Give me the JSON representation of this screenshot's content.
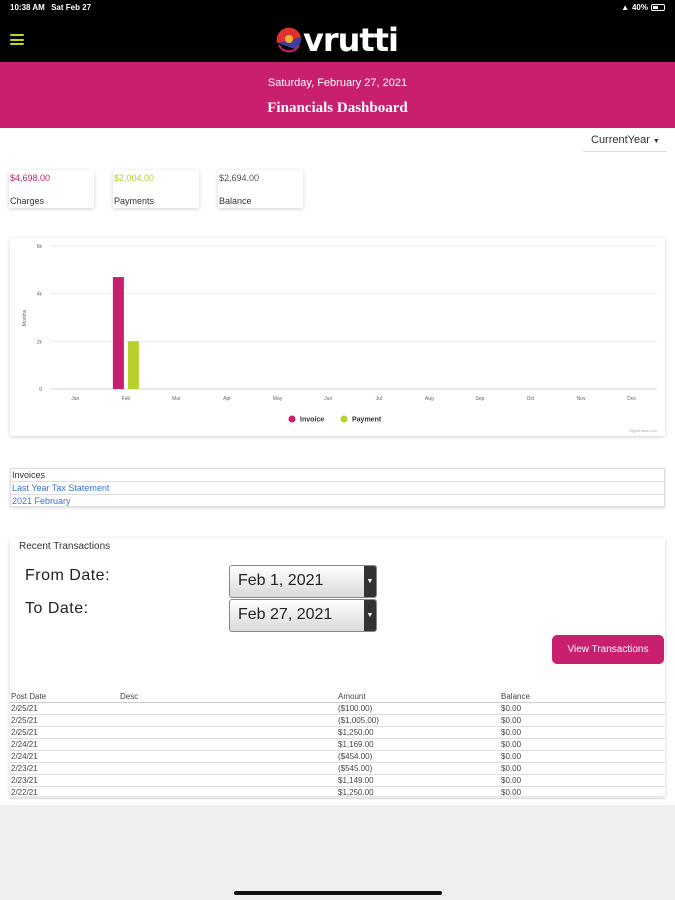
{
  "status": {
    "time": "10:38 AM",
    "date": "Sat Feb 27",
    "battery": "40%"
  },
  "app": {
    "logo_text": "vrutti"
  },
  "header": {
    "date": "Saturday, February 27, 2021",
    "title": "Financials Dashboard"
  },
  "year_filter": {
    "selected": "CurrentYear"
  },
  "summary": [
    {
      "amount": "$4,698.00",
      "label": "Charges",
      "color": "#c81f6e"
    },
    {
      "amount": "$2,004.00",
      "label": "Payments",
      "color": "#b8cf2c"
    },
    {
      "amount": "$2,694.00",
      "label": "Balance",
      "color": "#555555"
    }
  ],
  "chart_data": {
    "type": "bar",
    "categories": [
      "Jan",
      "Feb",
      "Mar",
      "Apr",
      "May",
      "Jun",
      "Jul",
      "Aug",
      "Sep",
      "Oct",
      "Nov",
      "Dec"
    ],
    "series": [
      {
        "name": "Invoice",
        "color": "#c81f6e",
        "values": [
          0,
          4698,
          0,
          0,
          0,
          0,
          0,
          0,
          0,
          0,
          0,
          0
        ]
      },
      {
        "name": "Payment",
        "color": "#b8cf2c",
        "values": [
          0,
          2004,
          0,
          0,
          0,
          0,
          0,
          0,
          0,
          0,
          0,
          0
        ]
      }
    ],
    "ylabel": "Months",
    "yticks": [
      "0",
      "2k",
      "4k",
      "6k"
    ],
    "ylim": [
      0,
      6000
    ],
    "legend_position": "bottom",
    "credit": "Highcharts.com"
  },
  "invoices": {
    "header": "Invoices",
    "links": [
      "Last Year Tax Statement",
      "2021 February"
    ]
  },
  "transactions": {
    "title": "Recent Transactions",
    "from_label": "From Date:",
    "to_label": "To Date:",
    "from_value": "Feb 1, 2021",
    "to_value": "Feb 27, 2021",
    "view_button": "View Transactions",
    "columns": [
      "Post Date",
      "Desc",
      "Amount",
      "Balance"
    ],
    "rows": [
      [
        "2/25/21",
        "",
        "($100.00)",
        "$0.00"
      ],
      [
        "2/25/21",
        "",
        "($1,005.00)",
        "$0.00"
      ],
      [
        "2/25/21",
        "",
        "$1,250.00",
        "$0.00"
      ],
      [
        "2/24/21",
        "",
        "$1,169.00",
        "$0.00"
      ],
      [
        "2/24/21",
        "",
        "($454.00)",
        "$0.00"
      ],
      [
        "2/23/21",
        "",
        "($545.00)",
        "$0.00"
      ],
      [
        "2/23/21",
        "",
        "$1,149.00",
        "$0.00"
      ],
      [
        "2/22/21",
        "",
        "$1,250.00",
        "$0.00"
      ]
    ]
  }
}
